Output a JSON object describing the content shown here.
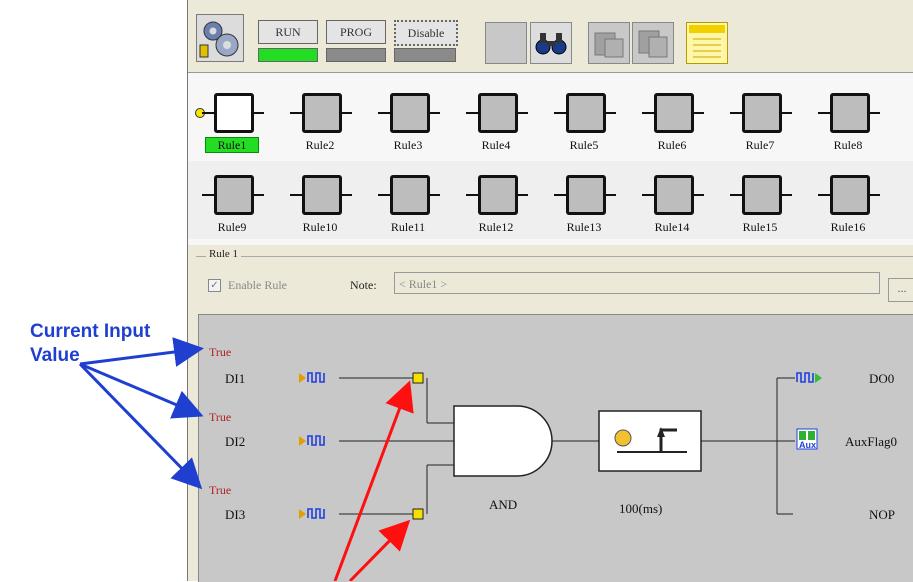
{
  "toolbar": {
    "run_label": "RUN",
    "prog_label": "PROG",
    "disable_label": "Disable",
    "run_status_color": "#22dd22",
    "icons": [
      "settings-gear-icon",
      "blank-square-icon",
      "binoculars-icon",
      "download-icon",
      "upload-icon",
      "notepad-icon"
    ]
  },
  "rules": {
    "row1": [
      "Rule1",
      "Rule2",
      "Rule3",
      "Rule4",
      "Rule5",
      "Rule6",
      "Rule7",
      "Rule8"
    ],
    "row2": [
      "Rule9",
      "Rule10",
      "Rule11",
      "Rule12",
      "Rule13",
      "Rule14",
      "Rule15",
      "Rule16"
    ],
    "selected": "Rule1"
  },
  "detail": {
    "group_title": "Rule 1",
    "enable_label": "Enable Rule",
    "note_label": "Note:",
    "note_value": "< Rule1 >",
    "browse_label": "..."
  },
  "diagram": {
    "inputs": [
      {
        "value": "True",
        "name": "DI1"
      },
      {
        "value": "True",
        "name": "DI2"
      },
      {
        "value": "True",
        "name": "DI3"
      }
    ],
    "gate_label": "AND",
    "timer_label": "100(ms)",
    "outputs": [
      "DO0",
      "AuxFlag0",
      "NOP"
    ],
    "aux_text": "Aux"
  },
  "annotation": {
    "line1": "Current Input",
    "line2": "Value",
    "color": "#1f3fd0",
    "arrow_color": "#ff1010"
  }
}
